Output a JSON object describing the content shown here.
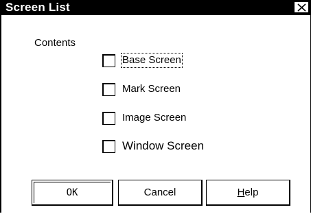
{
  "dialog": {
    "title": "Screen List"
  },
  "contents_label": "Contents",
  "checkboxes": [
    {
      "label": "Base Screen",
      "checked": false,
      "focused": true
    },
    {
      "label": "Mark Screen",
      "checked": false
    },
    {
      "label": "Image Screen",
      "checked": false
    },
    {
      "label": "Window Screen",
      "checked": false
    }
  ],
  "buttons": {
    "ok": "OK",
    "cancel": "Cancel",
    "help_mnemonic": "H",
    "help_rest": "elp"
  },
  "icons": {
    "close": "close-icon"
  }
}
